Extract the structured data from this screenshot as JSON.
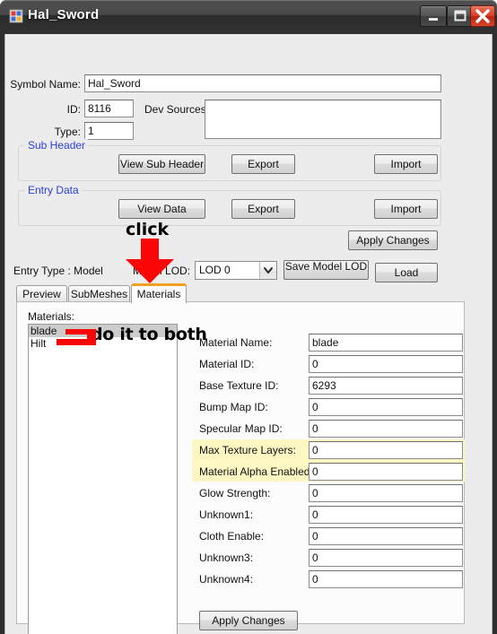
{
  "window": {
    "title": "Hal_Sword",
    "icon": "app-blocks-icon",
    "buttons": {
      "minimize": "minimize-icon",
      "maximize": "maximize-icon",
      "close": "close-icon"
    }
  },
  "header": {
    "symbol_name_label": "Symbol Name:",
    "symbol_name_value": "Hal_Sword",
    "id_label": "ID:",
    "id_value": "8116",
    "type_label": "Type:",
    "type_value": "1",
    "dev_sources_label": "Dev Sources:",
    "dev_sources_value": ""
  },
  "sub_header_group": {
    "legend": "Sub Header",
    "view_button": "View Sub Header",
    "export_button": "Export",
    "import_button": "Import"
  },
  "entry_data_group": {
    "legend": "Entry Data",
    "view_button": "View Data",
    "export_button": "Export",
    "import_button": "Import"
  },
  "toolbar": {
    "apply_changes": "Apply Changes",
    "entry_type": "Entry Type : Model",
    "model_lod_label": "Model LOD:",
    "lod_selected": "LOD 0",
    "lod_options": [
      "LOD 0"
    ],
    "save_model_lod": "Save Model LOD",
    "load": "Load"
  },
  "tabs": [
    {
      "label": "Preview",
      "selected": false
    },
    {
      "label": "SubMeshes",
      "selected": false
    },
    {
      "label": "Materials",
      "selected": true
    }
  ],
  "materials_panel": {
    "list_label": "Materials:",
    "items": [
      {
        "name": "blade",
        "selected": true
      },
      {
        "name": "Hilt",
        "selected": false
      }
    ],
    "fields": [
      {
        "label": "Material Name:",
        "value": "blade",
        "highlighted": false
      },
      {
        "label": "Material ID:",
        "value": "0",
        "highlighted": false
      },
      {
        "label": "Base Texture ID:",
        "value": "6293",
        "highlighted": false
      },
      {
        "label": "Bump Map ID:",
        "value": "0",
        "highlighted": false
      },
      {
        "label": "Specular Map ID:",
        "value": "0",
        "highlighted": false
      },
      {
        "label": "Max Texture Layers:",
        "value": "0",
        "highlighted": true
      },
      {
        "label": "Material Alpha Enabled:",
        "value": "0",
        "highlighted": true
      },
      {
        "label": "Glow Strength:",
        "value": "0",
        "highlighted": false
      },
      {
        "label": "Unknown1:",
        "value": "0",
        "highlighted": false
      },
      {
        "label": "Cloth Enable:",
        "value": "0",
        "highlighted": false
      },
      {
        "label": "Unknown3:",
        "value": "0",
        "highlighted": false
      },
      {
        "label": "Unknown4:",
        "value": "0",
        "highlighted": false
      }
    ],
    "apply_changes": "Apply Changes"
  },
  "annotations": {
    "click_text": "click",
    "do_it_to_both_text": "do it to both",
    "arrow_color": "#fb0606",
    "bracket_color": "#fb0606"
  },
  "colors": {
    "group_legend": "#2a3fe0",
    "tab_accent": "#f0a020",
    "highlight_band": "#fdf7c3",
    "titlebar_top": "#4e4e4e",
    "titlebar_bottom": "#313131",
    "close_button": "#d93e27"
  }
}
